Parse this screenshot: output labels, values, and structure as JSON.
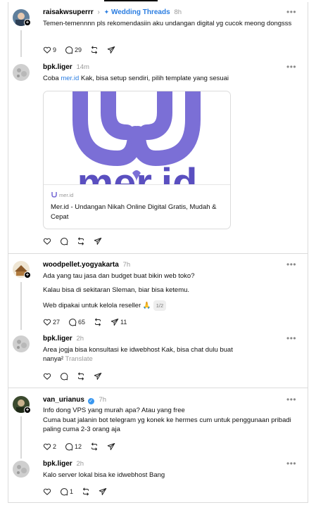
{
  "posts": [
    {
      "username": "raisakwsuperrr",
      "community": "Wedding Threads",
      "time": "8h",
      "text": "Temen-temennnn pls rekomendasiin aku undangan digital yg cucok meong dongsss",
      "likes": "9",
      "replies": "29"
    },
    {
      "username": "bpk.liger",
      "time": "14m",
      "text_prefix": "Coba ",
      "link_text": "mer.id",
      "text_suffix": " Kak, bisa setup sendiri, pilih template yang sesuai",
      "card": {
        "domain": "mer.id",
        "title": "Mer.id - Undangan Nikah Online Digital Gratis, Mudah & Cepat",
        "logo_text": "mer.id",
        "brand_color": "#7b6fd6"
      }
    },
    {
      "username": "woodpellet.yogyakarta",
      "time": "7h",
      "line1": "Ada yang tau jasa dan budget buat bikin web toko?",
      "line2": "Kalau bisa di sekitaran Sleman, biar bisa ketemu.",
      "line3": "Web dipakai untuk kelola reseller 🙏",
      "page_indicator": "1/2",
      "likes": "27",
      "replies": "65",
      "shares": "11"
    },
    {
      "username": "bpk.liger",
      "time": "2h",
      "text": "Area jogja bisa konsultasi ke idwebhost Kak, bisa chat dulu buat nanya²",
      "translate": "Translate"
    },
    {
      "username": "van_urianus",
      "time": "7h",
      "line1": "Info dong VPS yang murah apa? Atau yang free",
      "line2": "Cuma buat jalanin bot telegram yg konek ke hermes cum untuk penggunaan pribadi paling cuma 2-3 orang aja",
      "likes": "2",
      "replies": "12"
    },
    {
      "username": "bpk.liger",
      "time": "2h",
      "text": "Kalo server lokal bisa ke idwebhost Bang",
      "replies": "1"
    }
  ],
  "colors": {
    "link": "#2a7de1",
    "verified": "#3897f0",
    "muted": "#999999"
  },
  "icons": [
    "heart-icon",
    "comment-icon",
    "repost-icon",
    "share-icon",
    "more-icon",
    "verified-icon",
    "follow-plus-icon",
    "chevron-right-icon"
  ]
}
